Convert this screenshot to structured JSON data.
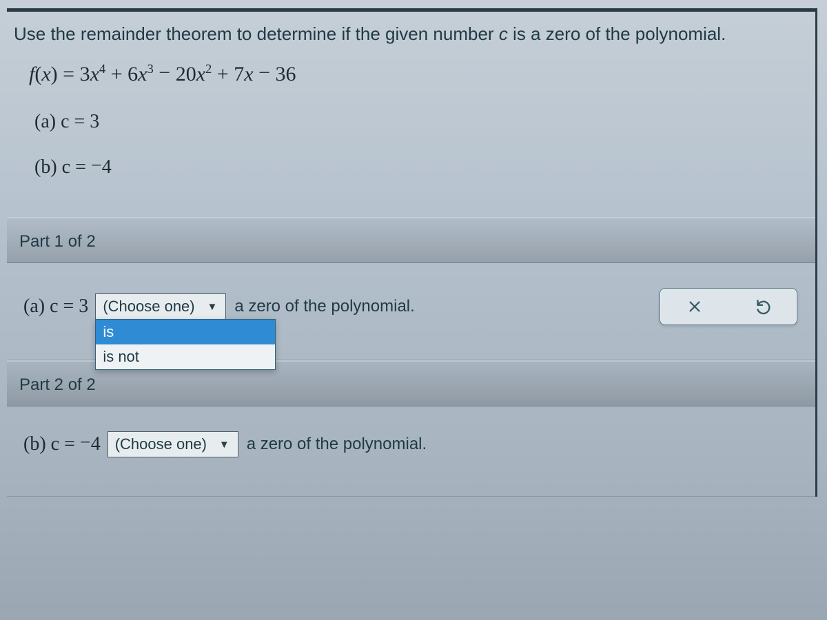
{
  "instruction": {
    "pre": "Use the remainder theorem to determine if the given number ",
    "var": "c",
    "post": " is a zero of the polynomial."
  },
  "polynomial": "f(x) = 3x^4 + 6x^3 − 20x^2 + 7x − 36",
  "given": {
    "a": "(a) c = 3",
    "b": "(b) c = −4"
  },
  "part1": {
    "header": "Part 1 of 2",
    "prefix": "(a) c = 3",
    "dropdown_label": "(Choose one)",
    "options": [
      "is",
      "is not"
    ],
    "selected_index": 0,
    "suffix": "a zero of the polynomial."
  },
  "part2": {
    "header": "Part 2 of 2",
    "prefix": "(b) c = −4",
    "dropdown_label": "(Choose one)",
    "suffix": "a zero of the polynomial."
  },
  "icons": {
    "clear": "clear",
    "undo": "undo"
  }
}
